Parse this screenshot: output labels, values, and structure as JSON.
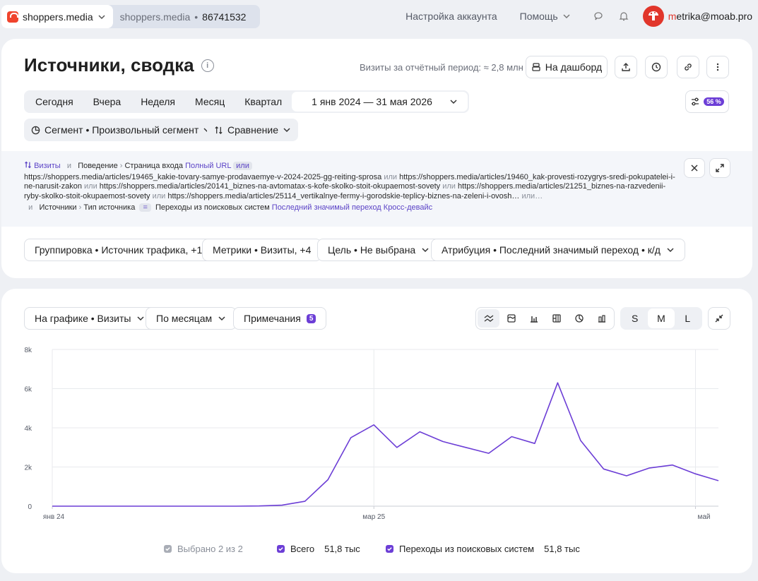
{
  "header": {
    "site_name": "shoppers.media",
    "counter_name": "shoppers.media",
    "counter_sep": "•",
    "counter_id": "86741532",
    "account_settings": "Настройка аккаунта",
    "help": "Помощь",
    "user_prefix": "m",
    "user_rest": "etrika@moab.pro"
  },
  "report": {
    "title": "Источники, сводка",
    "visits_summary": "Визиты за отчётный период: ≈ 2,8 млн",
    "dashboard_btn": "На дашборд",
    "periods": [
      "Сегодня",
      "Вчера",
      "Неделя",
      "Месяц",
      "Квартал"
    ],
    "date_range": "1 янв 2024 — 31 мая 2026",
    "sample_badge": "56 %",
    "segment_btn": "Сегмент • Произвольный сегмент",
    "compare_btn": "Сравнение"
  },
  "filters": {
    "line1": {
      "metric": "Визиты",
      "and1": "и",
      "cat": "Поведение",
      "sub": "Страница входа",
      "field": "Полный URL",
      "op": "или"
    },
    "urls": [
      "https://shoppers.media/articles/19465_kakie-tovary-samye-prodavaemye-v-2024-2025-gg-reiting-sprosa",
      "https://shoppers.media/articles/19460_kak-provesti-rozygrys-sredi-pokupatelei-i-ne-narusit-zakon",
      "https://shoppers.media/articles/20141_biznes-na-avtomatax-s-kofe-skolko-stoit-okupaemost-sovety",
      "https://shoppers.media/articles/21251_biznes-na-razvedenii-ryby-skolko-stoit-okupaemost-sovety",
      "https://shoppers.media/articles/25114_vertikalnye-fermy-i-gorodskie-teplicy-biznes-na-zeleni-i-ovosh…"
    ],
    "or_word": "или",
    "tail": "или…",
    "line3": {
      "and": "и",
      "cat": "Источники",
      "sub": "Тип источника",
      "op": "=",
      "value": "Переходы из поисковых систем",
      "attr1": "Последний значимый переход",
      "attr2": "Кросс-девайс"
    }
  },
  "controls": {
    "grouping": "Группировка • Источник трафика, +1",
    "metrics": "Метрики • Визиты, +4",
    "goal": "Цель • Не выбрана",
    "attribution": "Атрибуция • Последний значимый переход • к/д"
  },
  "chart_controls": {
    "on_chart": "На графике • Визиты",
    "by_period": "По месяцам",
    "notes": "Примечания",
    "notes_count": "5",
    "sizes": [
      "S",
      "M",
      "L"
    ],
    "size_selected": "M"
  },
  "chart_data": {
    "type": "line",
    "y_ticks": [
      "0",
      "2k",
      "4k",
      "6k",
      "8k"
    ],
    "ylim": [
      0,
      8000
    ],
    "x_tick_labels": [
      {
        "label": "янв 24",
        "index": 0
      },
      {
        "label": "мар 25",
        "index": 14
      },
      {
        "label": "май",
        "index": 28
      }
    ],
    "color": "#6c3ed6",
    "values": [
      0,
      0,
      0,
      0,
      0,
      0,
      0,
      0,
      0,
      10,
      50,
      250,
      1350,
      3500,
      4150,
      3000,
      3800,
      3300,
      3000,
      2700,
      3550,
      3200,
      6300,
      3350,
      1900,
      1550,
      1950,
      2100,
      1650,
      1300
    ]
  },
  "legend": {
    "selected": "Выбрано 2 из 2",
    "items": [
      {
        "name": "Всего",
        "value": "51,8 тыс"
      },
      {
        "name": "Переходы из поисковых систем",
        "value": "51,8 тыс"
      }
    ]
  }
}
